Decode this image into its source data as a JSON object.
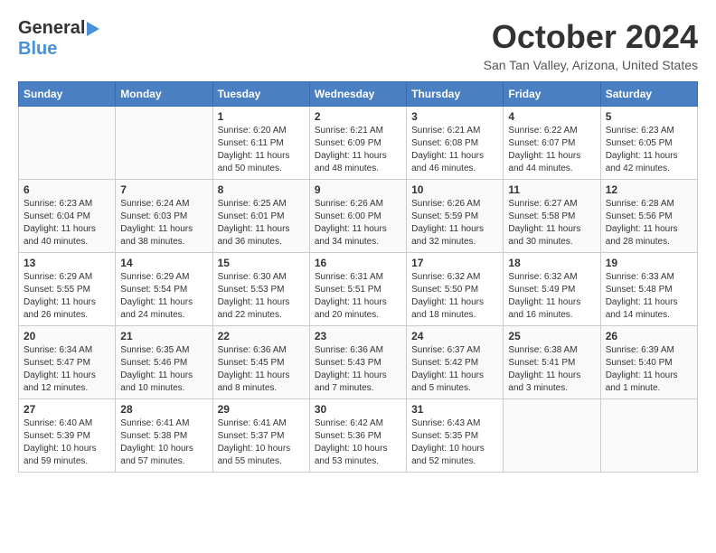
{
  "header": {
    "logo_line1": "General",
    "logo_line2": "Blue",
    "month_title": "October 2024",
    "location": "San Tan Valley, Arizona, United States"
  },
  "columns": [
    "Sunday",
    "Monday",
    "Tuesday",
    "Wednesday",
    "Thursday",
    "Friday",
    "Saturday"
  ],
  "weeks": [
    [
      {
        "day": "",
        "info": ""
      },
      {
        "day": "",
        "info": ""
      },
      {
        "day": "1",
        "info": "Sunrise: 6:20 AM\nSunset: 6:11 PM\nDaylight: 11 hours\nand 50 minutes."
      },
      {
        "day": "2",
        "info": "Sunrise: 6:21 AM\nSunset: 6:09 PM\nDaylight: 11 hours\nand 48 minutes."
      },
      {
        "day": "3",
        "info": "Sunrise: 6:21 AM\nSunset: 6:08 PM\nDaylight: 11 hours\nand 46 minutes."
      },
      {
        "day": "4",
        "info": "Sunrise: 6:22 AM\nSunset: 6:07 PM\nDaylight: 11 hours\nand 44 minutes."
      },
      {
        "day": "5",
        "info": "Sunrise: 6:23 AM\nSunset: 6:05 PM\nDaylight: 11 hours\nand 42 minutes."
      }
    ],
    [
      {
        "day": "6",
        "info": "Sunrise: 6:23 AM\nSunset: 6:04 PM\nDaylight: 11 hours\nand 40 minutes."
      },
      {
        "day": "7",
        "info": "Sunrise: 6:24 AM\nSunset: 6:03 PM\nDaylight: 11 hours\nand 38 minutes."
      },
      {
        "day": "8",
        "info": "Sunrise: 6:25 AM\nSunset: 6:01 PM\nDaylight: 11 hours\nand 36 minutes."
      },
      {
        "day": "9",
        "info": "Sunrise: 6:26 AM\nSunset: 6:00 PM\nDaylight: 11 hours\nand 34 minutes."
      },
      {
        "day": "10",
        "info": "Sunrise: 6:26 AM\nSunset: 5:59 PM\nDaylight: 11 hours\nand 32 minutes."
      },
      {
        "day": "11",
        "info": "Sunrise: 6:27 AM\nSunset: 5:58 PM\nDaylight: 11 hours\nand 30 minutes."
      },
      {
        "day": "12",
        "info": "Sunrise: 6:28 AM\nSunset: 5:56 PM\nDaylight: 11 hours\nand 28 minutes."
      }
    ],
    [
      {
        "day": "13",
        "info": "Sunrise: 6:29 AM\nSunset: 5:55 PM\nDaylight: 11 hours\nand 26 minutes."
      },
      {
        "day": "14",
        "info": "Sunrise: 6:29 AM\nSunset: 5:54 PM\nDaylight: 11 hours\nand 24 minutes."
      },
      {
        "day": "15",
        "info": "Sunrise: 6:30 AM\nSunset: 5:53 PM\nDaylight: 11 hours\nand 22 minutes."
      },
      {
        "day": "16",
        "info": "Sunrise: 6:31 AM\nSunset: 5:51 PM\nDaylight: 11 hours\nand 20 minutes."
      },
      {
        "day": "17",
        "info": "Sunrise: 6:32 AM\nSunset: 5:50 PM\nDaylight: 11 hours\nand 18 minutes."
      },
      {
        "day": "18",
        "info": "Sunrise: 6:32 AM\nSunset: 5:49 PM\nDaylight: 11 hours\nand 16 minutes."
      },
      {
        "day": "19",
        "info": "Sunrise: 6:33 AM\nSunset: 5:48 PM\nDaylight: 11 hours\nand 14 minutes."
      }
    ],
    [
      {
        "day": "20",
        "info": "Sunrise: 6:34 AM\nSunset: 5:47 PM\nDaylight: 11 hours\nand 12 minutes."
      },
      {
        "day": "21",
        "info": "Sunrise: 6:35 AM\nSunset: 5:46 PM\nDaylight: 11 hours\nand 10 minutes."
      },
      {
        "day": "22",
        "info": "Sunrise: 6:36 AM\nSunset: 5:45 PM\nDaylight: 11 hours\nand 8 minutes."
      },
      {
        "day": "23",
        "info": "Sunrise: 6:36 AM\nSunset: 5:43 PM\nDaylight: 11 hours\nand 7 minutes."
      },
      {
        "day": "24",
        "info": "Sunrise: 6:37 AM\nSunset: 5:42 PM\nDaylight: 11 hours\nand 5 minutes."
      },
      {
        "day": "25",
        "info": "Sunrise: 6:38 AM\nSunset: 5:41 PM\nDaylight: 11 hours\nand 3 minutes."
      },
      {
        "day": "26",
        "info": "Sunrise: 6:39 AM\nSunset: 5:40 PM\nDaylight: 11 hours\nand 1 minute."
      }
    ],
    [
      {
        "day": "27",
        "info": "Sunrise: 6:40 AM\nSunset: 5:39 PM\nDaylight: 10 hours\nand 59 minutes."
      },
      {
        "day": "28",
        "info": "Sunrise: 6:41 AM\nSunset: 5:38 PM\nDaylight: 10 hours\nand 57 minutes."
      },
      {
        "day": "29",
        "info": "Sunrise: 6:41 AM\nSunset: 5:37 PM\nDaylight: 10 hours\nand 55 minutes."
      },
      {
        "day": "30",
        "info": "Sunrise: 6:42 AM\nSunset: 5:36 PM\nDaylight: 10 hours\nand 53 minutes."
      },
      {
        "day": "31",
        "info": "Sunrise: 6:43 AM\nSunset: 5:35 PM\nDaylight: 10 hours\nand 52 minutes."
      },
      {
        "day": "",
        "info": ""
      },
      {
        "day": "",
        "info": ""
      }
    ]
  ]
}
